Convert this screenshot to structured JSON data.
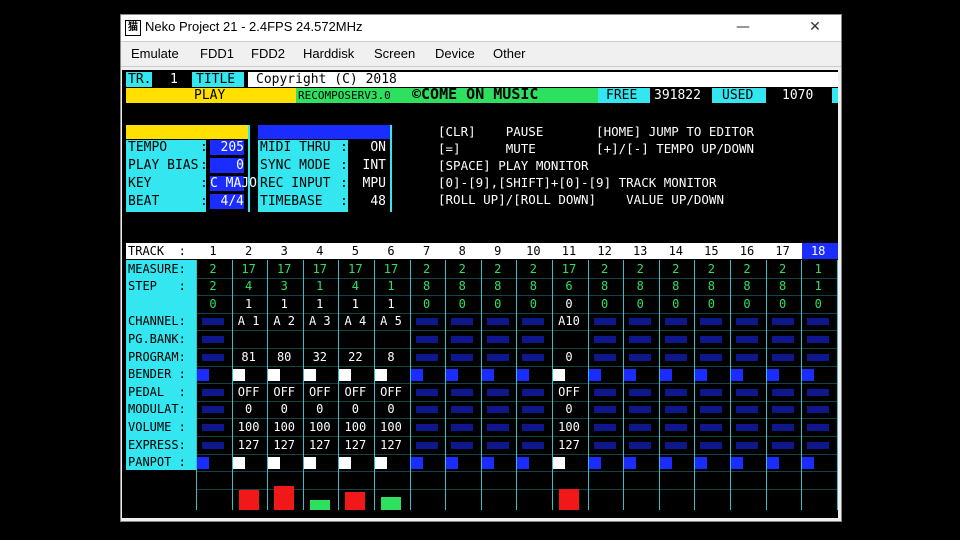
{
  "window": {
    "title": "Neko Project 21 - 2.4FPS 24.572MHz",
    "minimize": "—",
    "close": "✕"
  },
  "menu": [
    "Emulate",
    "FDD1",
    "FDD2",
    "Harddisk",
    "Screen",
    "Device",
    "Other"
  ],
  "header": {
    "tr_label": "TR.",
    "tr_value": "1",
    "title_label": "TITLE",
    "title_value": "Copyright (C) 2018",
    "play": "PLAY",
    "recomposer": "RECOMPOSERV3.0",
    "come_on": "©COME ON MUSIC",
    "free_label": "FREE",
    "free_value": "391822",
    "used_label": "USED",
    "used_value": "1070"
  },
  "params_left": [
    {
      "label": "TEMPO",
      "sep": ":",
      "value": "205"
    },
    {
      "label": "PLAY BIAS",
      "sep": ":",
      "value": "0"
    },
    {
      "label": "KEY",
      "sep": ":",
      "value": "C MAJOR"
    },
    {
      "label": "BEAT",
      "sep": ":",
      "value": "4/4"
    }
  ],
  "params_right": [
    {
      "label": "MIDI THRU",
      "sep": ":",
      "value": "ON"
    },
    {
      "label": "SYNC MODE",
      "sep": ":",
      "value": "INT"
    },
    {
      "label": "REC INPUT",
      "sep": ":",
      "value": "MPU"
    },
    {
      "label": "TIMEBASE",
      "sep": ":",
      "value": "48"
    }
  ],
  "help": [
    "[CLR]    PAUSE       [HOME] JUMP TO EDITOR",
    "[=]      MUTE        [+]/[-] TEMPO UP/DOWN",
    "[SPACE] PLAY MONITOR",
    "[0]-[9],[SHIFT]+[0]-[9] TRACK MONITOR",
    "[ROLL UP]/[ROLL DOWN]    VALUE UP/DOWN"
  ],
  "grid": {
    "row_labels": [
      "TRACK  :",
      "MEASURE:",
      "STEP   :",
      "",
      "CHANNEL:",
      "PG.BANK:",
      "PROGRAM:",
      "BENDER :",
      "PEDAL  :",
      "MODULAT:",
      "VOLUME :",
      "EXPRESS:",
      "PANPOT :",
      "",
      ""
    ],
    "track_numbers": [
      "1",
      "2",
      "3",
      "4",
      "5",
      "6",
      "7",
      "8",
      "9",
      "10",
      "11",
      "12",
      "13",
      "14",
      "15",
      "16",
      "17",
      "18"
    ],
    "measure": [
      "2",
      "17",
      "17",
      "17",
      "17",
      "17",
      "2",
      "2",
      "2",
      "2",
      "17",
      "2",
      "2",
      "2",
      "2",
      "2",
      "2",
      "1"
    ],
    "step": [
      "2",
      "4",
      "3",
      "1",
      "4",
      "1",
      "8",
      "8",
      "8",
      "8",
      "6",
      "8",
      "8",
      "8",
      "8",
      "8",
      "8",
      "1"
    ],
    "third": [
      "0",
      "1",
      "1",
      "1",
      "1",
      "1",
      "0",
      "0",
      "0",
      "0",
      "0",
      "0",
      "0",
      "0",
      "0",
      "0",
      "0",
      "0"
    ],
    "channel": [
      "",
      "A 1",
      "A 2",
      "A 3",
      "A 4",
      "A 5",
      "",
      "",
      "",
      "",
      "A10",
      "",
      "",
      "",
      "",
      "",
      "",
      ""
    ],
    "program": [
      "",
      "81",
      "80",
      "32",
      "22",
      "8",
      "",
      "",
      "",
      "",
      "0",
      "",
      "",
      "",
      "",
      "",
      "",
      ""
    ],
    "pedal": [
      "",
      "OFF",
      "OFF",
      "OFF",
      "OFF",
      "OFF",
      "",
      "",
      "",
      "",
      "OFF",
      "",
      "",
      "",
      "",
      "",
      "",
      ""
    ],
    "modulat": [
      "",
      "0",
      "0",
      "0",
      "0",
      "0",
      "",
      "",
      "",
      "",
      "0",
      "",
      "",
      "",
      "",
      "",
      "",
      ""
    ],
    "volume": [
      "",
      "100",
      "100",
      "100",
      "100",
      "100",
      "",
      "",
      "",
      "",
      "100",
      "",
      "",
      "",
      "",
      "",
      "",
      ""
    ],
    "express": [
      "",
      "127",
      "127",
      "127",
      "127",
      "127",
      "",
      "",
      "",
      "",
      "127",
      "",
      "",
      "",
      "",
      "",
      "",
      ""
    ],
    "level_meter": [
      0,
      0.7,
      0.85,
      0.35,
      0.65,
      0.45,
      0,
      0,
      0,
      0,
      0.75,
      0,
      0,
      0,
      0,
      0,
      0,
      0
    ]
  },
  "colors": {
    "cyan": "#33e6f0",
    "yellow": "#ffe000",
    "green": "#2ee060",
    "blue": "#1a2cff",
    "red": "#f01818"
  }
}
